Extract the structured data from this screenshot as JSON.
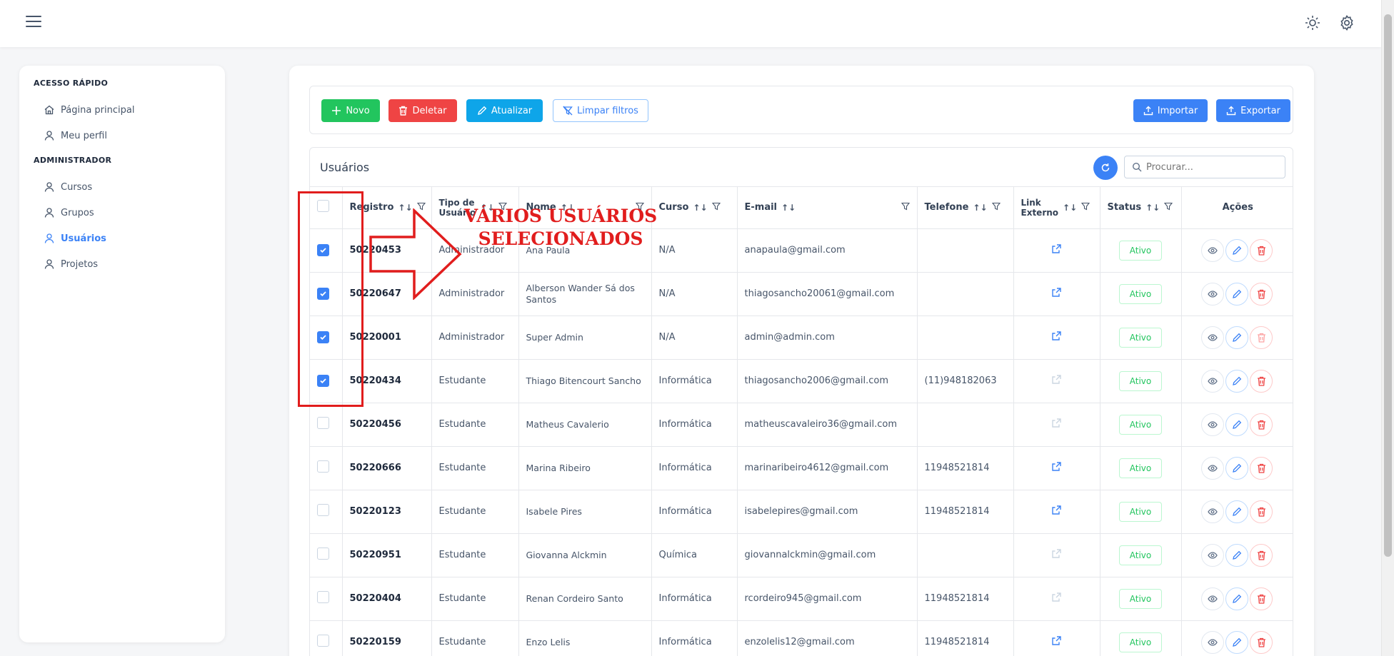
{
  "topbar": {
    "menu_icon": "hamburger-icon",
    "theme_icon": "sun-icon",
    "settings_icon": "gear-icon"
  },
  "sidebar": {
    "section1": "ACESSO RÁPIDO",
    "quick_items": [
      {
        "label": "Página principal",
        "icon": "home-icon"
      },
      {
        "label": "Meu perfil",
        "icon": "user-icon"
      }
    ],
    "section2": "ADMINISTRADOR",
    "admin_items": [
      {
        "label": "Cursos",
        "icon": "user-icon"
      },
      {
        "label": "Grupos",
        "icon": "user-icon"
      },
      {
        "label": "Usuários",
        "icon": "user-icon",
        "active": true
      },
      {
        "label": "Projetos",
        "icon": "user-icon"
      }
    ]
  },
  "toolbar": {
    "new_label": "Novo",
    "delete_label": "Deletar",
    "update_label": "Atualizar",
    "clear_filters_label": "Limpar filtros",
    "import_label": "Importar",
    "export_label": "Exportar"
  },
  "table": {
    "title": "Usuários",
    "search_placeholder": "Procurar...",
    "columns": {
      "registro": "Registro",
      "tipo_line1": "Tipo de",
      "tipo_line2": "Usuário",
      "nome": "Nome",
      "curso": "Curso",
      "email": "E-mail",
      "telefone": "Telefone",
      "link_line1": "Link",
      "link_line2": "Externo",
      "status": "Status",
      "acoes": "Ações"
    },
    "rows": [
      {
        "registro": "50220453",
        "tipo": "Administrador",
        "nome": "Ana Paula",
        "curso": "N/A",
        "email": "anapaula@gmail.com",
        "telefone": "",
        "status": "Ativo",
        "selected": true,
        "link_active": true,
        "delete_active": true
      },
      {
        "registro": "50220647",
        "tipo": "Administrador",
        "nome": "Alberson Wander Sá dos Santos",
        "curso": "N/A",
        "email": "thiagosancho20061@gmail.com",
        "telefone": "",
        "status": "Ativo",
        "selected": true,
        "link_active": true,
        "delete_active": true
      },
      {
        "registro": "50220001",
        "tipo": "Administrador",
        "nome": "Super Admin",
        "curso": "N/A",
        "email": "admin@admin.com",
        "telefone": "",
        "status": "Ativo",
        "selected": true,
        "link_active": true,
        "delete_active": false
      },
      {
        "registro": "50220434",
        "tipo": "Estudante",
        "nome": "Thiago Bitencourt Sancho",
        "curso": "Informática",
        "email": "thiagosancho2006@gmail.com",
        "telefone": "(11)948182063",
        "status": "Ativo",
        "selected": true,
        "link_active": false,
        "delete_active": true
      },
      {
        "registro": "50220456",
        "tipo": "Estudante",
        "nome": "Matheus Cavalerio",
        "curso": "Informática",
        "email": "matheuscavaleiro36@gmail.com",
        "telefone": "",
        "status": "Ativo",
        "selected": false,
        "link_active": false,
        "delete_active": true
      },
      {
        "registro": "50220666",
        "tipo": "Estudante",
        "nome": "Marina Ribeiro",
        "curso": "Informática",
        "email": "marinaribeiro4612@gmail.com",
        "telefone": "11948521814",
        "status": "Ativo",
        "selected": false,
        "link_active": true,
        "delete_active": true
      },
      {
        "registro": "50220123",
        "tipo": "Estudante",
        "nome": "Isabele Pires",
        "curso": "Informática",
        "email": "isabelepires@gmail.com",
        "telefone": "11948521814",
        "status": "Ativo",
        "selected": false,
        "link_active": true,
        "delete_active": true
      },
      {
        "registro": "50220951",
        "tipo": "Estudante",
        "nome": "Giovanna Alckmin",
        "curso": "Química",
        "email": "giovannalckmin@gmail.com",
        "telefone": "",
        "status": "Ativo",
        "selected": false,
        "link_active": false,
        "delete_active": true
      },
      {
        "registro": "50220404",
        "tipo": "Estudante",
        "nome": "Renan Cordeiro Santo",
        "curso": "Informática",
        "email": "rcordeiro945@gmail.com",
        "telefone": "11948521814",
        "status": "Ativo",
        "selected": false,
        "link_active": false,
        "delete_active": true
      },
      {
        "registro": "50220159",
        "tipo": "Estudante",
        "nome": "Enzo Lelis",
        "curso": "Informática",
        "email": "enzolelis12@gmail.com",
        "telefone": "11948521814",
        "status": "Ativo",
        "selected": false,
        "link_active": true,
        "delete_active": true
      }
    ]
  },
  "annotation": {
    "line1": "VÁRIOS USUÁRIOS",
    "line2": "SELECIONADOS"
  },
  "colors": {
    "primary": "#3b82f6",
    "success": "#22c55e",
    "danger": "#ef4444",
    "annotation": "#e11d1d"
  }
}
